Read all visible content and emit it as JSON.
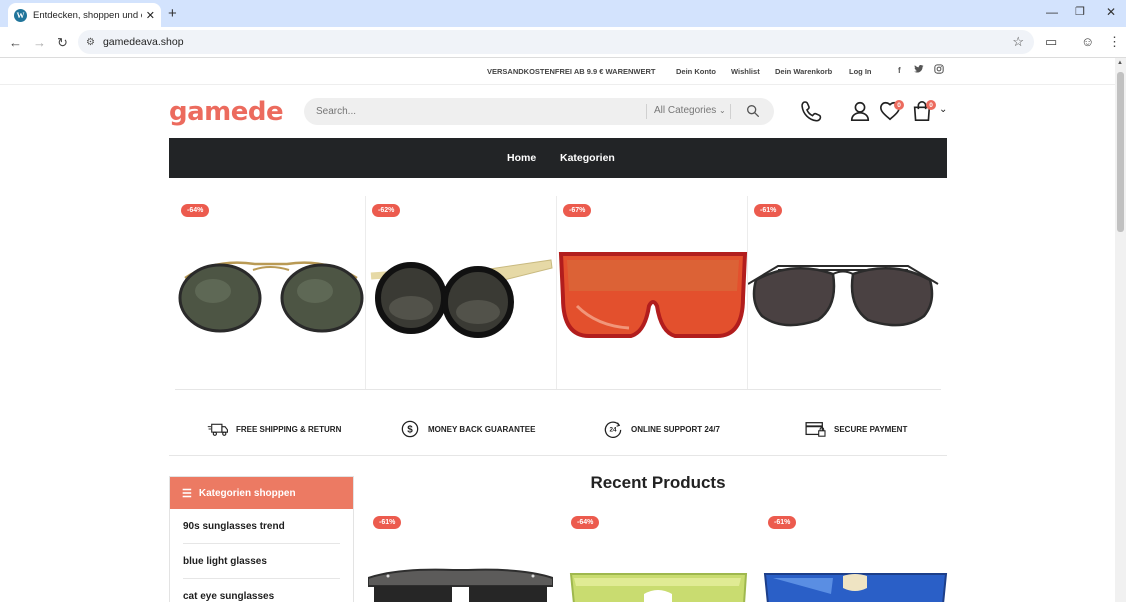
{
  "browser": {
    "tab_title": "Entdecken, shoppen und einkaufen",
    "url": "gamedeava.shop",
    "new_tab": "+",
    "tab_close": "✕"
  },
  "topbar": {
    "promo": "VERSANDKOSTENFREI AB 9.9 € WARENWERT",
    "links": [
      "Dein Konto",
      "Wishlist",
      "Dein Warenkorb",
      "Log In"
    ],
    "social": [
      "f",
      "t",
      "ig"
    ]
  },
  "header": {
    "logo": "gamede",
    "search_placeholder": "Search...",
    "category_select": "All Categories",
    "wishlist_count": "0",
    "cart_count": "0"
  },
  "nav": {
    "items": [
      "Home",
      "Kategorien"
    ]
  },
  "carousel": {
    "products": [
      {
        "discount": "-64%"
      },
      {
        "discount": "-62%"
      },
      {
        "discount": "-67%"
      },
      {
        "discount": "-61%"
      }
    ]
  },
  "features": [
    {
      "label": "FREE SHIPPING & RETURN",
      "icon": "truck-icon"
    },
    {
      "label": "MONEY BACK GUARANTEE",
      "icon": "dollar-circle-icon"
    },
    {
      "label": "ONLINE SUPPORT 24/7",
      "icon": "support-24-icon"
    },
    {
      "label": "SECURE PAYMENT",
      "icon": "credit-card-lock-icon"
    }
  ],
  "sidebar": {
    "title": "Kategorien shoppen",
    "items": [
      "90s sunglasses trend",
      "blue light glasses",
      "cat eye sunglasses"
    ]
  },
  "recent": {
    "title": "Recent Products",
    "products": [
      {
        "discount": "-61%"
      },
      {
        "discount": "-64%"
      },
      {
        "discount": "-61%"
      }
    ]
  },
  "colors": {
    "brand": "#ec6b5e",
    "discount_badge": "#ec5b4e",
    "nav_bg": "#222426",
    "sidebar_head": "#ec7a63"
  }
}
